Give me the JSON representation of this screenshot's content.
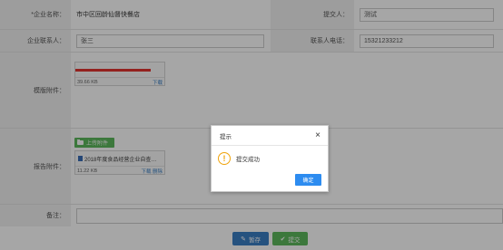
{
  "fields": {
    "company_name_label": "*企业名称：",
    "company_name_value": "市中区回龄仙督快餐店",
    "submitter_label": "提交人：",
    "submitter_value": "测试",
    "contact_label": "企业联系人：",
    "contact_value": "张三",
    "phone_label": "联系人电话：",
    "phone_value": "15321233212",
    "template_label": "模版附件：",
    "report_label": "报告附件：",
    "remark_label": "备注："
  },
  "template_file": {
    "size": "39.66 KB",
    "download": "下载"
  },
  "upload_button": "上传附件",
  "report_file": {
    "name": "2018年度食品经营企业自查报告...",
    "size": "11.22 KB",
    "download": "下载",
    "delete": "删除"
  },
  "buttons": {
    "save": "暂存",
    "submit": "提交"
  },
  "dialog": {
    "title": "提示",
    "message": "提交成功",
    "ok": "确定",
    "close_glyph": "×",
    "warn_glyph": "!"
  },
  "colors": {
    "upload_green": "#5cb85c",
    "save_blue": "#3a7fc4",
    "submit_green": "#5cb85c",
    "ok_blue": "#2d8cf0",
    "annotation_red": "#e3342f"
  }
}
